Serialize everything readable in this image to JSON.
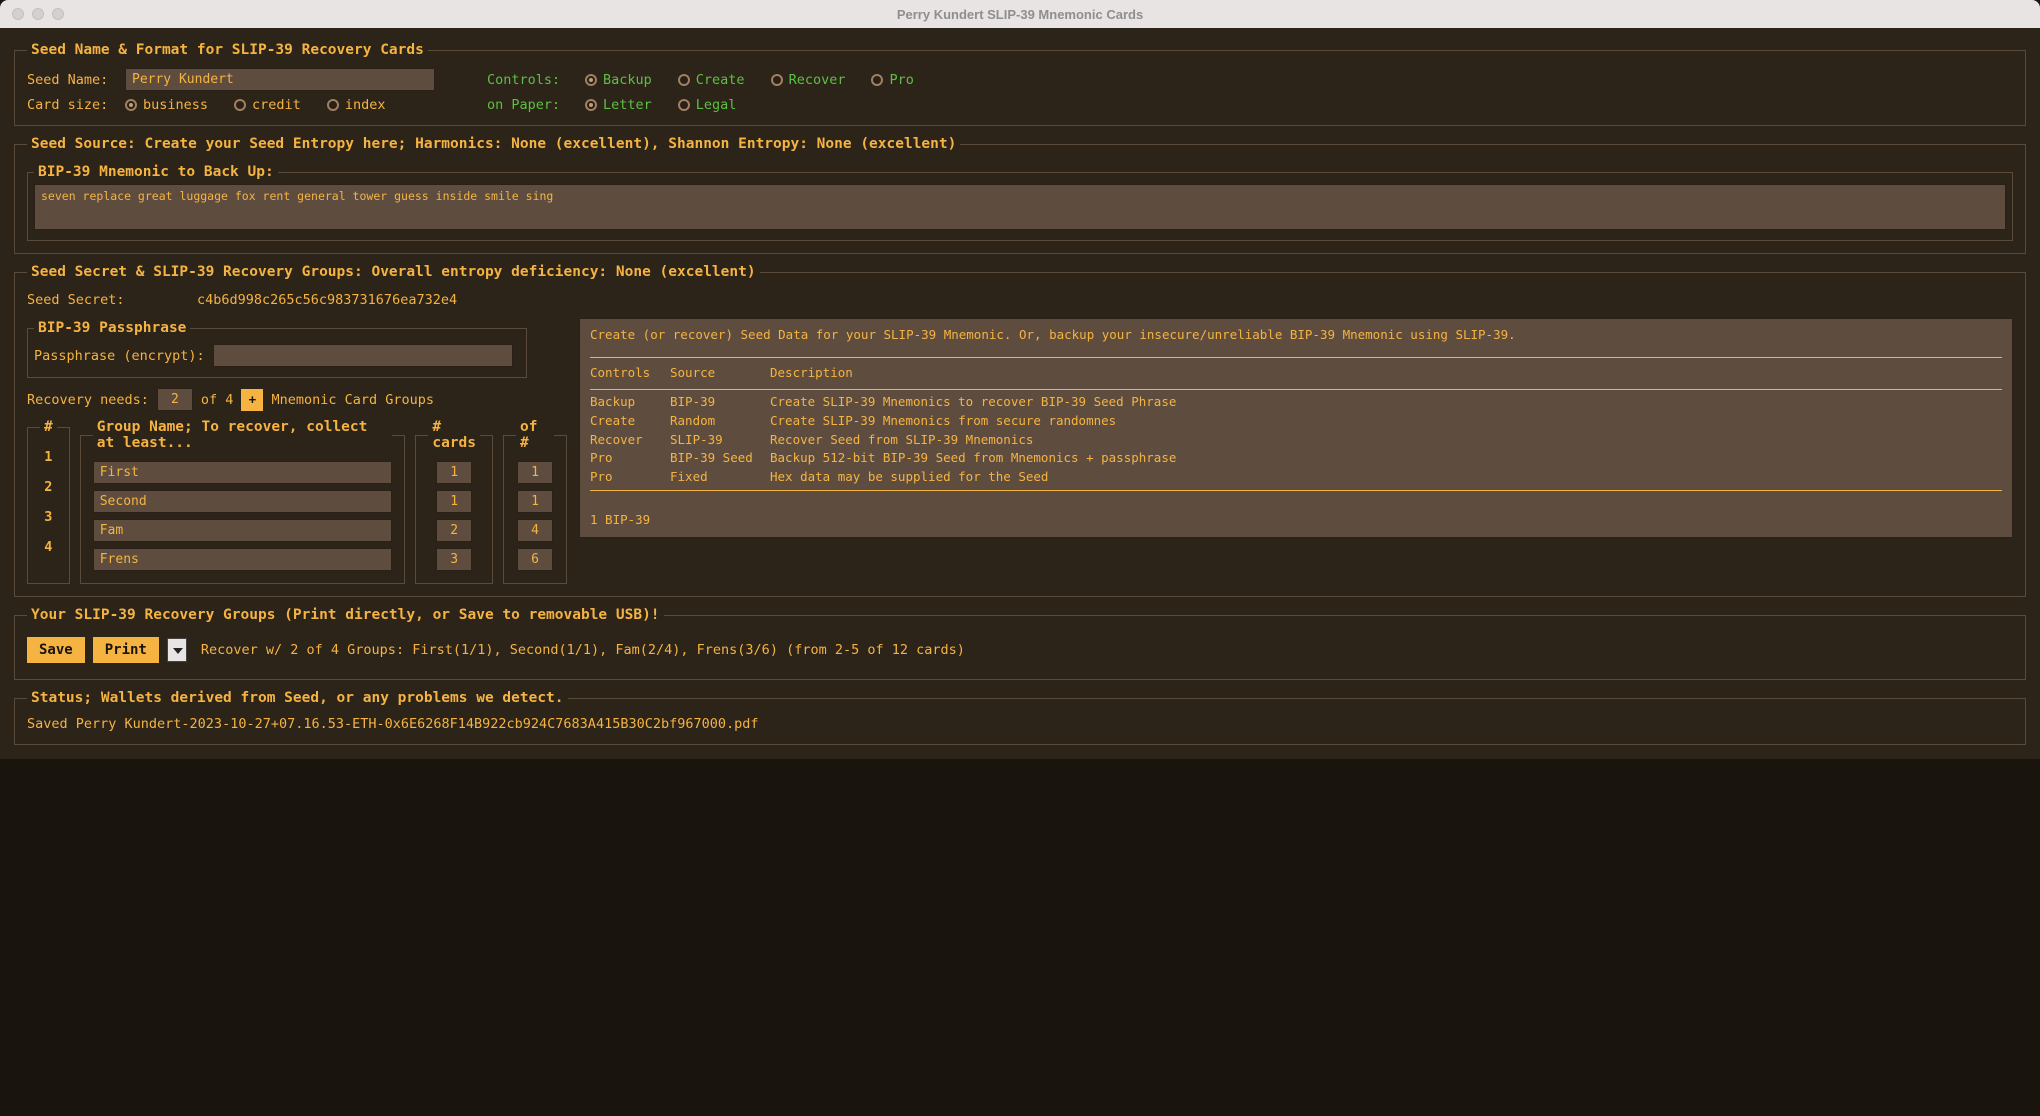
{
  "window": {
    "title": "Perry Kundert SLIP-39 Mnemonic Cards"
  },
  "section1": {
    "legend": "Seed Name & Format for SLIP-39 Recovery Cards",
    "seed_name_label": "Seed Name:",
    "seed_name_value": "Perry Kundert",
    "controls_label": "Controls:",
    "controls_opts": {
      "backup": "Backup",
      "create": "Create",
      "recover": "Recover",
      "pro": "Pro"
    },
    "card_size_label": "Card size:",
    "card_sizes": {
      "business": "business",
      "credit": "credit",
      "index": "index"
    },
    "on_paper_label": "on Paper:",
    "paper_opts": {
      "letter": "Letter",
      "legal": "Legal"
    }
  },
  "section2": {
    "legend": "Seed Source: Create your Seed Entropy here; Harmonics: None (excellent), Shannon Entropy: None (excellent)",
    "sub_legend": "BIP-39 Mnemonic to Back Up:",
    "mnemonic": "seven replace great luggage fox rent general tower guess inside smile sing"
  },
  "section3": {
    "legend": "Seed Secret & SLIP-39 Recovery Groups: Overall entropy deficiency: None (excellent)",
    "seed_secret_label": "Seed Secret:",
    "seed_secret_value": "c4b6d998c265c56c983731676ea732e4",
    "passphrase_legend": "BIP-39 Passphrase",
    "passphrase_label": "Passphrase (encrypt):",
    "passphrase_value": "",
    "recovery_needs_label": "Recovery needs:",
    "recovery_needs_value": "2",
    "recovery_of": "of 4",
    "plus": "+",
    "mnemonic_groups_label": "Mnemonic Card Groups",
    "num_legend": "#",
    "name_legend": "Group Name; To recover, collect at least...",
    "cards_legend": "# cards",
    "of_legend": "of #",
    "groups": [
      {
        "idx": "1",
        "name": "First",
        "cards": "1",
        "of": "1"
      },
      {
        "idx": "2",
        "name": "Second",
        "cards": "1",
        "of": "1"
      },
      {
        "idx": "3",
        "name": "Fam",
        "cards": "2",
        "of": "4"
      },
      {
        "idx": "4",
        "name": "Frens",
        "cards": "3",
        "of": "6"
      }
    ],
    "info_intro": "Create (or recover) Seed Data for your SLIP-39 Mnemonic.  Or, backup your insecure/unreliable BIP-39 Mnemonic using SLIP-39.",
    "info_header": {
      "controls": "Controls",
      "source": "Source",
      "desc": "Description"
    },
    "info_rows": [
      {
        "controls": "Backup",
        "source": "BIP-39",
        "desc": "Create SLIP-39 Mnemonics to recover BIP-39 Seed Phrase"
      },
      {
        "controls": "Create",
        "source": "Random",
        "desc": "Create SLIP-39 Mnemonics from secure randomnes"
      },
      {
        "controls": "Recover",
        "source": "SLIP-39",
        "desc": "Recover Seed from SLIP-39 Mnemonics"
      },
      {
        "controls": "Pro",
        "source": "BIP-39 Seed",
        "desc": "Backup 512-bit BIP-39 Seed from Mnemonics + passphrase"
      },
      {
        "controls": "Pro",
        "source": "Fixed",
        "desc": "Hex data may be supplied for the Seed"
      }
    ],
    "info_footer": "1 BIP-39"
  },
  "section4": {
    "legend": "Your SLIP-39 Recovery Groups (Print directly, or Save to removable USB)!",
    "save": "Save",
    "print": "Print",
    "summary": "Recover w/ 2 of 4 Groups: First(1/1), Second(1/1), Fam(2/4), Frens(3/6) (from 2-5 of 12 cards)"
  },
  "section5": {
    "legend": "Status; Wallets derived from Seed, or any problems we detect.",
    "status": "Saved Perry Kundert-2023-10-27+07.16.53-ETH-0x6E6268F14B922cb924C7683A415B30C2bf967000.pdf"
  }
}
